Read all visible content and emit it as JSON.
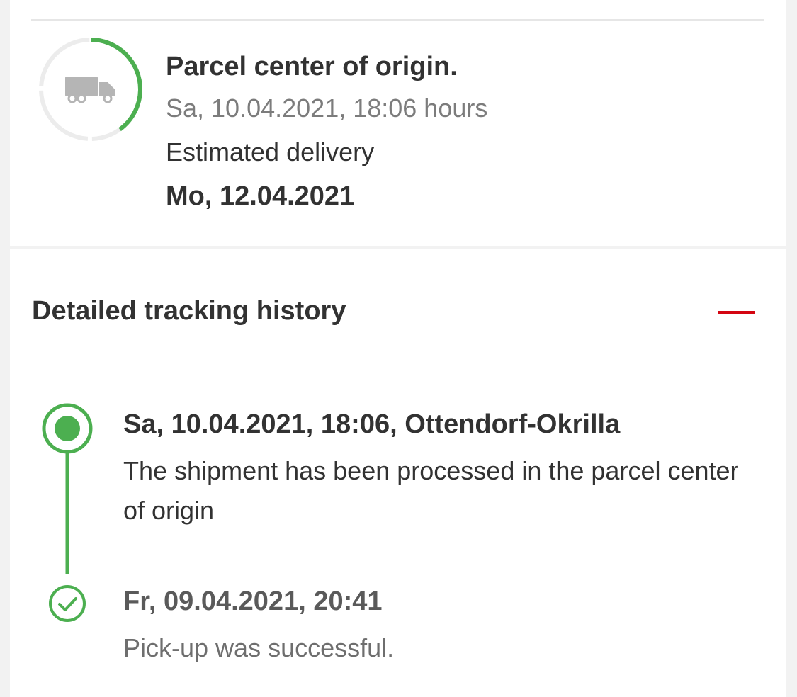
{
  "status": {
    "title": "Parcel center of origin.",
    "timestamp": "Sa, 10.04.2021, 18:06 hours",
    "estimated_label": "Estimated delivery",
    "estimated_date": "Mo, 12.04.2021",
    "progress_fraction": 0.4,
    "icon": "truck-icon"
  },
  "history": {
    "title": "Detailed tracking history",
    "collapse_icon": "minus-icon",
    "events": [
      {
        "heading": "Sa, 10.04.2021, 18:06, Ottendorf-Okrilla",
        "description": "The shipment has been processed in the parcel center of origin",
        "state": "current"
      },
      {
        "heading": "Fr, 09.04.2021, 20:41",
        "description": "Pick-up was successful.",
        "state": "completed"
      }
    ]
  },
  "colors": {
    "accent_green": "#4caf50",
    "collapse_red": "#d40511",
    "text_dark": "#323232",
    "text_muted": "#7c7c7c"
  }
}
